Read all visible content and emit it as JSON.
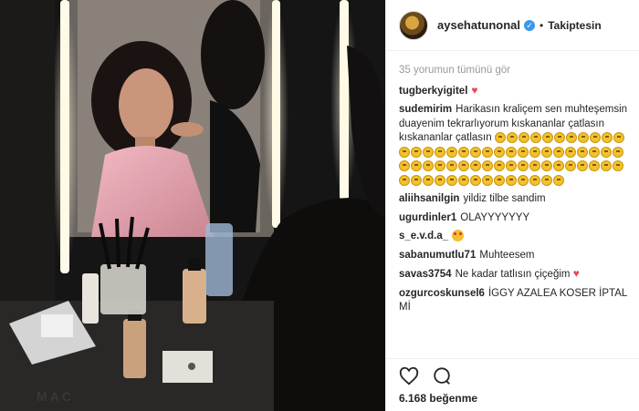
{
  "post": {
    "username": "aysehatunonal",
    "verified": true,
    "separator": "•",
    "follow_status": "Takiptesin"
  },
  "comments": {
    "view_all_label": "35 yorumun tümünü gör",
    "items": [
      {
        "user": "tugberkyigitel",
        "text": "",
        "has_heart": true
      },
      {
        "user": "sudemirim",
        "text": "Harikasın kraliçem sen muhteşemsin duayenim tekrarlıyorum kıskananlar çatlasın kıskananlar çatlasın",
        "emoji_count": 63
      },
      {
        "user": "aliihsanilgin",
        "text": "yildiz tilbe sandim"
      },
      {
        "user": "ugurdinler1",
        "text": "OLAYYYYYYY"
      },
      {
        "user": "s_e.v.d.a_",
        "text": "",
        "has_face": true
      },
      {
        "user": "sabanumutlu71",
        "text": "Muhteesem"
      },
      {
        "user": "savas3754",
        "text": "Ne kadar tatlısın çiçeğim",
        "has_heart": true
      },
      {
        "user": "ozgurcoskunsel6",
        "text": "İGGY AZALEA KOSER İPTAL Mİ"
      }
    ]
  },
  "actions": {
    "like_icon": "heart-outline-icon",
    "comment_icon": "comment-bubble-icon"
  },
  "likes": "6.168 beğenme",
  "colors": {
    "verified_blue": "#3897f0",
    "heart_red": "#ed4956",
    "muted_gray": "#999999"
  },
  "photo": {
    "caption_on_table": "MAC"
  }
}
